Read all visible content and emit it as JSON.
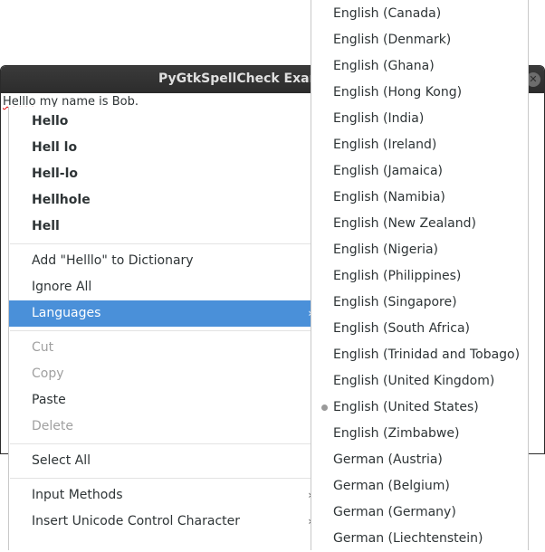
{
  "window": {
    "title": "PyGtkSpellCheck Examp",
    "text_prefix": "Helllo",
    "text_suffix": " my name is Bob."
  },
  "context_menu": {
    "suggestions": [
      "Hello",
      "Hell lo",
      "Hell-lo",
      "Hellhole",
      "Hell"
    ],
    "add_to_dictionary": "Add \"Helllo\" to Dictionary",
    "ignore_all": "Ignore All",
    "languages": "Languages",
    "cut": "Cut",
    "copy": "Copy",
    "paste": "Paste",
    "delete": "Delete",
    "select_all": "Select All",
    "input_methods": "Input Methods",
    "insert_unicode": "Insert Unicode Control Character",
    "submenu_arrow": "›",
    "highlight_color": "#4a90d9"
  },
  "languages_submenu": {
    "selected": "English (United States)",
    "items": [
      "English (Canada)",
      "English (Denmark)",
      "English (Ghana)",
      "English (Hong Kong)",
      "English (India)",
      "English (Ireland)",
      "English (Jamaica)",
      "English (Namibia)",
      "English (New Zealand)",
      "English (Nigeria)",
      "English (Philippines)",
      "English (Singapore)",
      "English (South Africa)",
      "English (Trinidad and Tobago)",
      "English (United Kingdom)",
      "English (United States)",
      "English (Zimbabwe)",
      "German (Austria)",
      "German (Belgium)",
      "German (Germany)",
      "German (Liechtenstein)"
    ]
  }
}
